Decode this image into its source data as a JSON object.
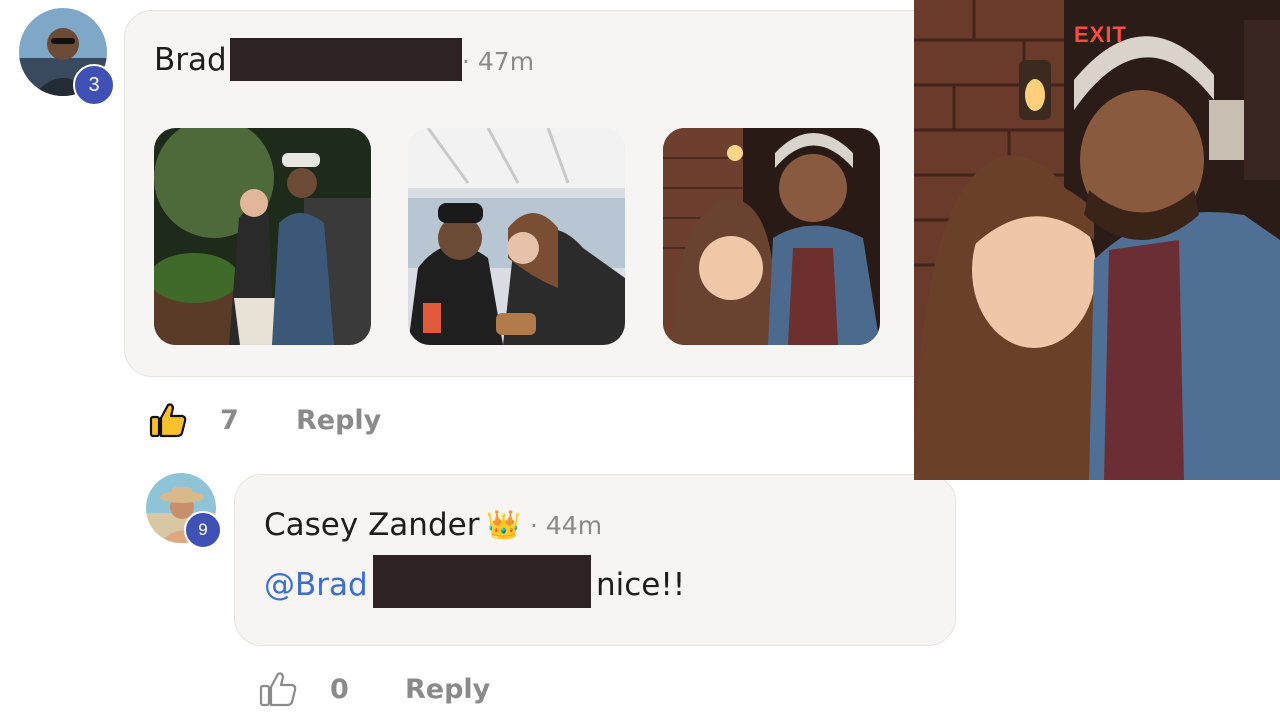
{
  "comment": {
    "author_first": "Brad",
    "time": "47m",
    "avatar_badge": "3",
    "like_count": "7",
    "reply_label": "Reply",
    "photos": [
      "photo-garden-couple",
      "photo-cafe-couple",
      "photo-bar-selfie"
    ]
  },
  "reply": {
    "author": "Casey Zander",
    "author_badge_emoji": "👑",
    "time": "44m",
    "avatar_badge": "9",
    "mention": "@Brad",
    "text": "nice!!",
    "like_count": "0",
    "reply_label": "Reply"
  },
  "overlay": {
    "sign": "EXIT"
  },
  "icons": {
    "like_filled": "thumbs-up-filled-icon",
    "like_outline": "thumbs-up-outline-icon"
  },
  "colors": {
    "badge": "#3f51b5",
    "mention": "#3a6ed6",
    "like_yellow": "#f7c12b"
  }
}
